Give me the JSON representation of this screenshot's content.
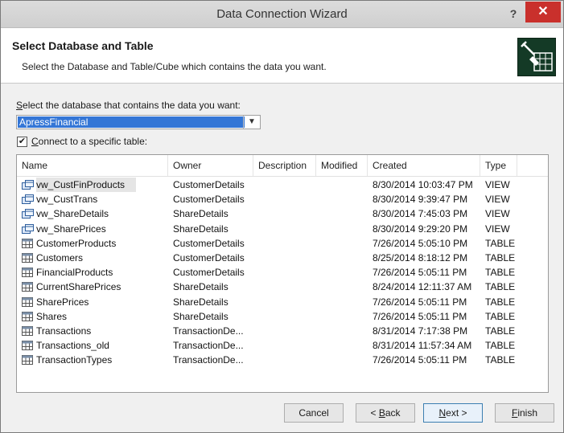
{
  "window": {
    "title": "Data Connection Wizard",
    "help_label": "?",
    "close_label": "✕"
  },
  "header": {
    "title": "Select Database and Table",
    "description": "Select the Database and Table/Cube which contains the data you want."
  },
  "database": {
    "label_accel": "S",
    "label_rest": "elect the database that contains the data you want:",
    "selected": "ApressFinancial"
  },
  "specific_table": {
    "checked": true,
    "label_accel": "C",
    "label_rest": "onnect to a specific table:"
  },
  "table": {
    "columns": [
      "Name",
      "Owner",
      "Description",
      "Modified",
      "Created",
      "Type"
    ],
    "rows": [
      {
        "name": "vw_CustFinProducts",
        "owner": "CustomerDetails",
        "description": "",
        "modified": "",
        "created": "8/30/2014 10:03:47 PM",
        "type": "VIEW",
        "icon": "view-icon"
      },
      {
        "name": "vw_CustTrans",
        "owner": "CustomerDetails",
        "description": "",
        "modified": "",
        "created": "8/30/2014 9:39:47 PM",
        "type": "VIEW",
        "icon": "view-icon"
      },
      {
        "name": "vw_ShareDetails",
        "owner": "ShareDetails",
        "description": "",
        "modified": "",
        "created": "8/30/2014 7:45:03 PM",
        "type": "VIEW",
        "icon": "view-icon"
      },
      {
        "name": "vw_SharePrices",
        "owner": "ShareDetails",
        "description": "",
        "modified": "",
        "created": "8/30/2014 9:29:20 PM",
        "type": "VIEW",
        "icon": "view-icon"
      },
      {
        "name": "CustomerProducts",
        "owner": "CustomerDetails",
        "description": "",
        "modified": "",
        "created": "7/26/2014 5:05:10 PM",
        "type": "TABLE",
        "icon": "table-icon"
      },
      {
        "name": "Customers",
        "owner": "CustomerDetails",
        "description": "",
        "modified": "",
        "created": "8/25/2014 8:18:12 PM",
        "type": "TABLE",
        "icon": "table-icon"
      },
      {
        "name": "FinancialProducts",
        "owner": "CustomerDetails",
        "description": "",
        "modified": "",
        "created": "7/26/2014 5:05:11 PM",
        "type": "TABLE",
        "icon": "table-icon"
      },
      {
        "name": "CurrentSharePrices",
        "owner": "ShareDetails",
        "description": "",
        "modified": "",
        "created": "8/24/2014 12:11:37 AM",
        "type": "TABLE",
        "icon": "table-icon"
      },
      {
        "name": "SharePrices",
        "owner": "ShareDetails",
        "description": "",
        "modified": "",
        "created": "7/26/2014 5:05:11 PM",
        "type": "TABLE",
        "icon": "table-icon"
      },
      {
        "name": "Shares",
        "owner": "ShareDetails",
        "description": "",
        "modified": "",
        "created": "7/26/2014 5:05:11 PM",
        "type": "TABLE",
        "icon": "table-icon"
      },
      {
        "name": "Transactions",
        "owner": "TransactionDe...",
        "description": "",
        "modified": "",
        "created": "8/31/2014 7:17:38 PM",
        "type": "TABLE",
        "icon": "table-icon"
      },
      {
        "name": "Transactions_old",
        "owner": "TransactionDe...",
        "description": "",
        "modified": "",
        "created": "8/31/2014 11:57:34 AM",
        "type": "TABLE",
        "icon": "table-icon"
      },
      {
        "name": "TransactionTypes",
        "owner": "TransactionDe...",
        "description": "",
        "modified": "",
        "created": "7/26/2014 5:05:11 PM",
        "type": "TABLE",
        "icon": "table-icon"
      }
    ]
  },
  "buttons": {
    "cancel": "Cancel",
    "back_prefix": "< ",
    "back_accel": "B",
    "back_rest": "ack",
    "next_accel": "N",
    "next_rest": "ext >",
    "finish_accel": "F",
    "finish_rest": "inish"
  },
  "colors": {
    "close": "#c9302c",
    "selection": "#3476d6",
    "header_icon": "#143a26"
  }
}
